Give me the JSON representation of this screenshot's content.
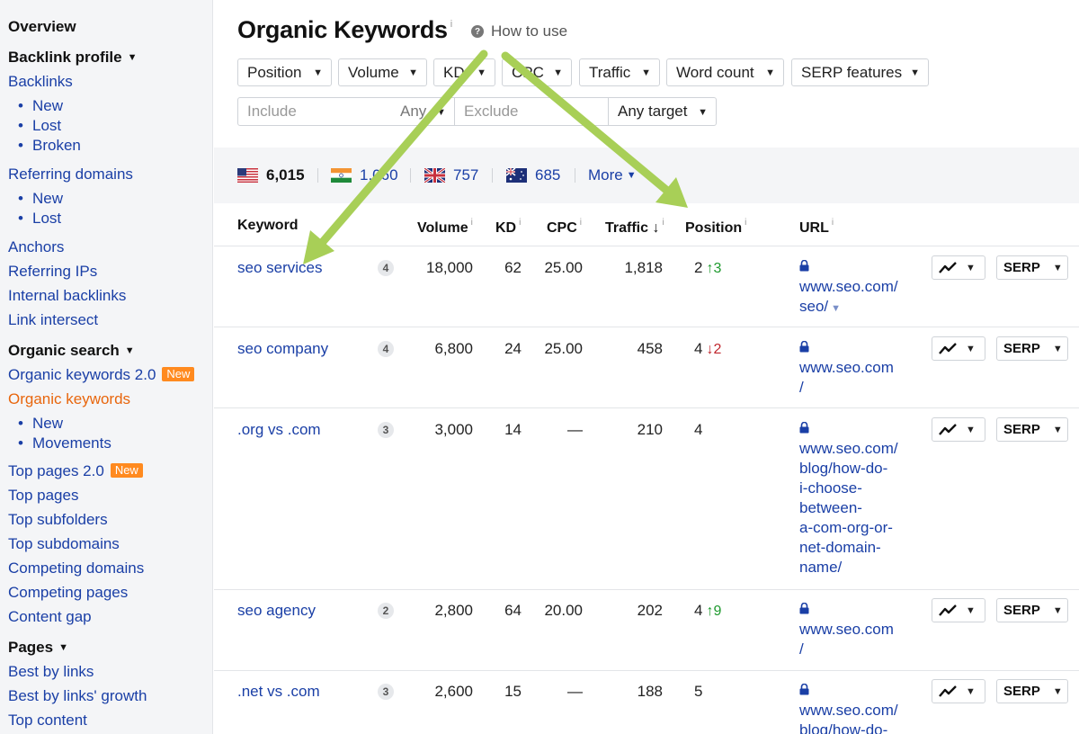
{
  "sidebar": {
    "overview": "Overview",
    "backlink_profile": "Backlink profile",
    "backlinks": "Backlinks",
    "backlinks_new": "New",
    "backlinks_lost": "Lost",
    "backlinks_broken": "Broken",
    "referring_domains": "Referring domains",
    "rd_new": "New",
    "rd_lost": "Lost",
    "anchors": "Anchors",
    "referring_ips": "Referring IPs",
    "internal_backlinks": "Internal backlinks",
    "link_intersect": "Link intersect",
    "organic_search": "Organic search",
    "organic_keywords_2": "Organic keywords 2.0",
    "new_badge": "New",
    "organic_keywords": "Organic keywords",
    "ok_new": "New",
    "ok_movements": "Movements",
    "top_pages_2": "Top pages 2.0",
    "top_pages": "Top pages",
    "top_subfolders": "Top subfolders",
    "top_subdomains": "Top subdomains",
    "competing_domains": "Competing domains",
    "competing_pages": "Competing pages",
    "content_gap": "Content gap",
    "pages": "Pages",
    "best_by_links": "Best by links",
    "best_by_links_growth": "Best by links' growth",
    "top_content": "Top content"
  },
  "header": {
    "title": "Organic Keywords",
    "info": "i",
    "how_to_use": "How to use"
  },
  "filters": {
    "position": "Position",
    "volume": "Volume",
    "kd": "KD",
    "cpc": "CPC",
    "traffic": "Traffic",
    "word_count": "Word count",
    "serp_features": "SERP features",
    "include_placeholder": "Include",
    "any": "Any",
    "exclude_placeholder": "Exclude",
    "any_target": "Any target"
  },
  "countries": {
    "us": "6,015",
    "in": "1,060",
    "gb": "757",
    "au": "685",
    "more": "More"
  },
  "table": {
    "headers": {
      "keyword": "Keyword",
      "volume": "Volume",
      "kd": "KD",
      "cpc": "CPC",
      "traffic": "Traffic",
      "traffic_sort": "↓",
      "position": "Position",
      "url": "URL",
      "info": "i"
    },
    "serp_label": "SERP",
    "rows": [
      {
        "keyword": "seo services",
        "serp_count": "4",
        "volume": "18,000",
        "kd": "62",
        "cpc": "25.00",
        "traffic": "1,818",
        "position": "2",
        "change_dir": "up",
        "change": "3",
        "url_lines": [
          "www.seo.com/",
          "seo/"
        ]
      },
      {
        "keyword": "seo company",
        "serp_count": "4",
        "volume": "6,800",
        "kd": "24",
        "cpc": "25.00",
        "traffic": "458",
        "position": "4",
        "change_dir": "down",
        "change": "2",
        "url_lines": [
          "www.seo.com",
          "/"
        ]
      },
      {
        "keyword": ".org vs .com",
        "serp_count": "3",
        "volume": "3,000",
        "kd": "14",
        "cpc": "—",
        "traffic": "210",
        "position": "4",
        "change_dir": "",
        "change": "",
        "url_lines": [
          "www.seo.com/",
          "blog/how-do-",
          "i-choose-",
          "between-",
          "a-com-org-or-",
          "net-domain-",
          "name/"
        ]
      },
      {
        "keyword": "seo agency",
        "serp_count": "2",
        "volume": "2,800",
        "kd": "64",
        "cpc": "20.00",
        "traffic": "202",
        "position": "4",
        "change_dir": "up",
        "change": "9",
        "url_lines": [
          "www.seo.com",
          "/"
        ]
      },
      {
        "keyword": ".net vs .com",
        "serp_count": "3",
        "volume": "2,600",
        "kd": "15",
        "cpc": "—",
        "traffic": "188",
        "position": "5",
        "change_dir": "",
        "change": "",
        "url_lines": [
          "www.seo.com/",
          "blog/how-do-"
        ]
      }
    ]
  },
  "colors": {
    "link": "#1a3fa6",
    "active": "#e8660d",
    "badge": "#ff8a1f",
    "up": "#1e9a2e",
    "down": "#c0262d",
    "annotation_arrow": "#9fc94a"
  }
}
